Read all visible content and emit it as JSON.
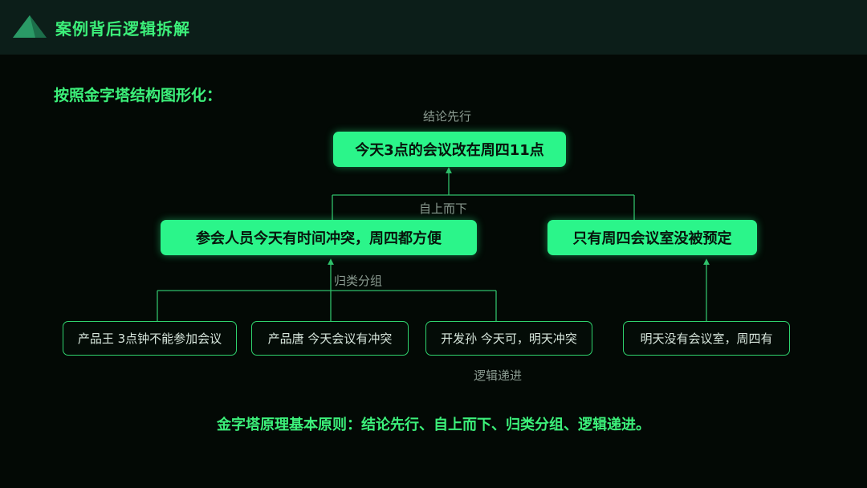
{
  "header": {
    "title": "案例背后逻辑拆解",
    "logo_icon": "pyramid-icon"
  },
  "intro": "按照金字塔结构图形化：",
  "labels": {
    "conclusion_first": "结论先行",
    "top_down": "自上而下",
    "group": "归类分组",
    "logic": "逻辑递进"
  },
  "top": "今天3点的会议改在周四11点",
  "middle": {
    "left": "参会人员今天有时间冲突，周四都方便",
    "right": "只有周四会议室没被预定"
  },
  "leaves": [
    "产品王 3点钟不能参加会议",
    "产品唐 今天会议有冲突",
    "开发孙 今天可，明天冲突",
    "明天没有会议室，周四有"
  ],
  "summary": "金字塔原理基本原则：结论先行、自上而下、归类分组、逻辑递进。",
  "colors": {
    "accent": "#2bf58a",
    "text_green": "#3cf07a",
    "background": "#030905",
    "header_bg": "#0c1e19"
  }
}
